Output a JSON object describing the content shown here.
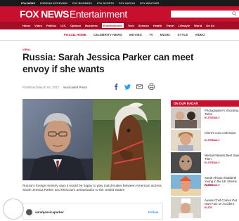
{
  "topstrip": {
    "items": [
      "FOX NEWS",
      "FOREIGN INTERVIEW",
      "FOX BUSINESS",
      "FOX SPORTS",
      "FOX NATION",
      "FOX WEATHER"
    ]
  },
  "header": {
    "logo_brand": "FOX NEWS",
    "logo_section": "Entertainment",
    "search_placeholder": ""
  },
  "mainnav": {
    "items": [
      "Home",
      "Video",
      "Politics",
      "U.S.",
      "Opinion",
      "Business",
      "Entertainment",
      "Tech",
      "Science",
      "Health",
      "Travel",
      "Lifestyle",
      "World",
      "On Air"
    ],
    "active": "Entertainment"
  },
  "subnav": {
    "items": [
      "FOX411 HOME",
      "CELEBRITY NEWS",
      "MOVIES",
      "TV",
      "MUSIC",
      "STYLE",
      "VIDEO"
    ]
  },
  "article": {
    "kicker": "VIRAL",
    "headline": "Russia: Sarah Jessica Parker can meet envoy if she wants",
    "date": "Published March 04, 2017",
    "source": "Associated Press",
    "caption": "Russia's foreign ministry says it would be happy to play matchmaker between American actress Sarah Jessica Parker and Moscow's ambassador to the United States",
    "embed_user": "sarahjessicaparker",
    "embed_action": "Follow"
  },
  "sidebar": {
    "title": "ON OUR RADAR",
    "items": [
      {
        "title": "Photographer's Shocking Twins",
        "tag": "ELITEDAILY"
      },
      {
        "title": "Client's coin confession",
        "tag": "ELITEDAILY"
      },
      {
        "title": "Mental Patients Best Saw Then",
        "tag": "ELITEDAILY"
      },
      {
        "title": "South African Shabbeth Young in the UK Xtreme Ayeet",
        "tag": "ELITEDAILY"
      },
      {
        "title": "Aussie Chef Comes Out Own Fact on Accident",
        "tag": "ELITE"
      }
    ]
  },
  "colors": {
    "brand_red": "#c8102e",
    "nav_dark_red": "#a30d25",
    "link_blue": "#3897f0"
  }
}
